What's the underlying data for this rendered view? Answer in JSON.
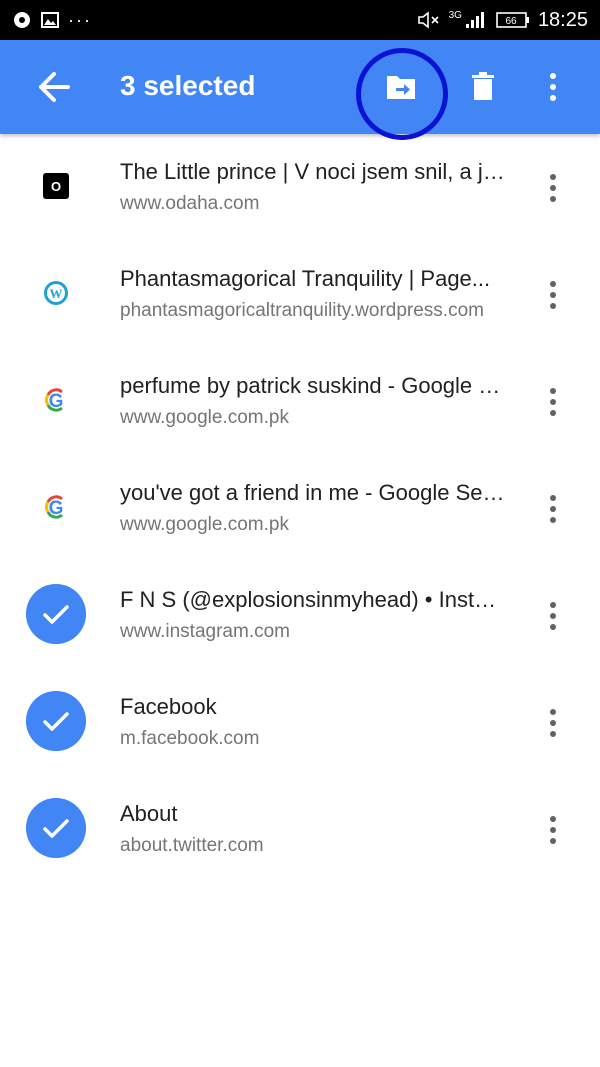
{
  "status_bar": {
    "time": "18:25",
    "network": "3G",
    "battery": "66",
    "dots": "···"
  },
  "app_bar": {
    "title": "3 selected",
    "back_icon": "arrow-back-icon",
    "move_icon": "folder-move-icon",
    "delete_icon": "trash-icon",
    "more_icon": "more-vert-icon"
  },
  "colors": {
    "accent": "#4285f4",
    "highlight_circle": "#0b12d6",
    "text_primary": "#202124",
    "text_secondary": "#757575"
  },
  "items": [
    {
      "title": "The Little prince | V noci jsem snil, a jsem snil...",
      "url": "www.odaha.com",
      "favicon": "odaha-icon",
      "selected": false
    },
    {
      "title": "Phantasmagorical Tranquility | Page...",
      "url": "phantasmagoricaltranquility.wordpress.com",
      "favicon": "wordpress-icon",
      "selected": false
    },
    {
      "title": "perfume by patrick suskind - Google Search",
      "url": "www.google.com.pk",
      "favicon": "google-icon",
      "selected": false
    },
    {
      "title": "you've got a friend in me - Google Search",
      "url": "www.google.com.pk",
      "favicon": "google-icon",
      "selected": false
    },
    {
      "title": "F N S (@explosionsinmyhead) • Instagram",
      "url": "www.instagram.com",
      "favicon": "check-icon",
      "selected": true
    },
    {
      "title": "Facebook",
      "url": "m.facebook.com",
      "favicon": "check-icon",
      "selected": true
    },
    {
      "title": "About",
      "url": "about.twitter.com",
      "favicon": "check-icon",
      "selected": true
    }
  ]
}
